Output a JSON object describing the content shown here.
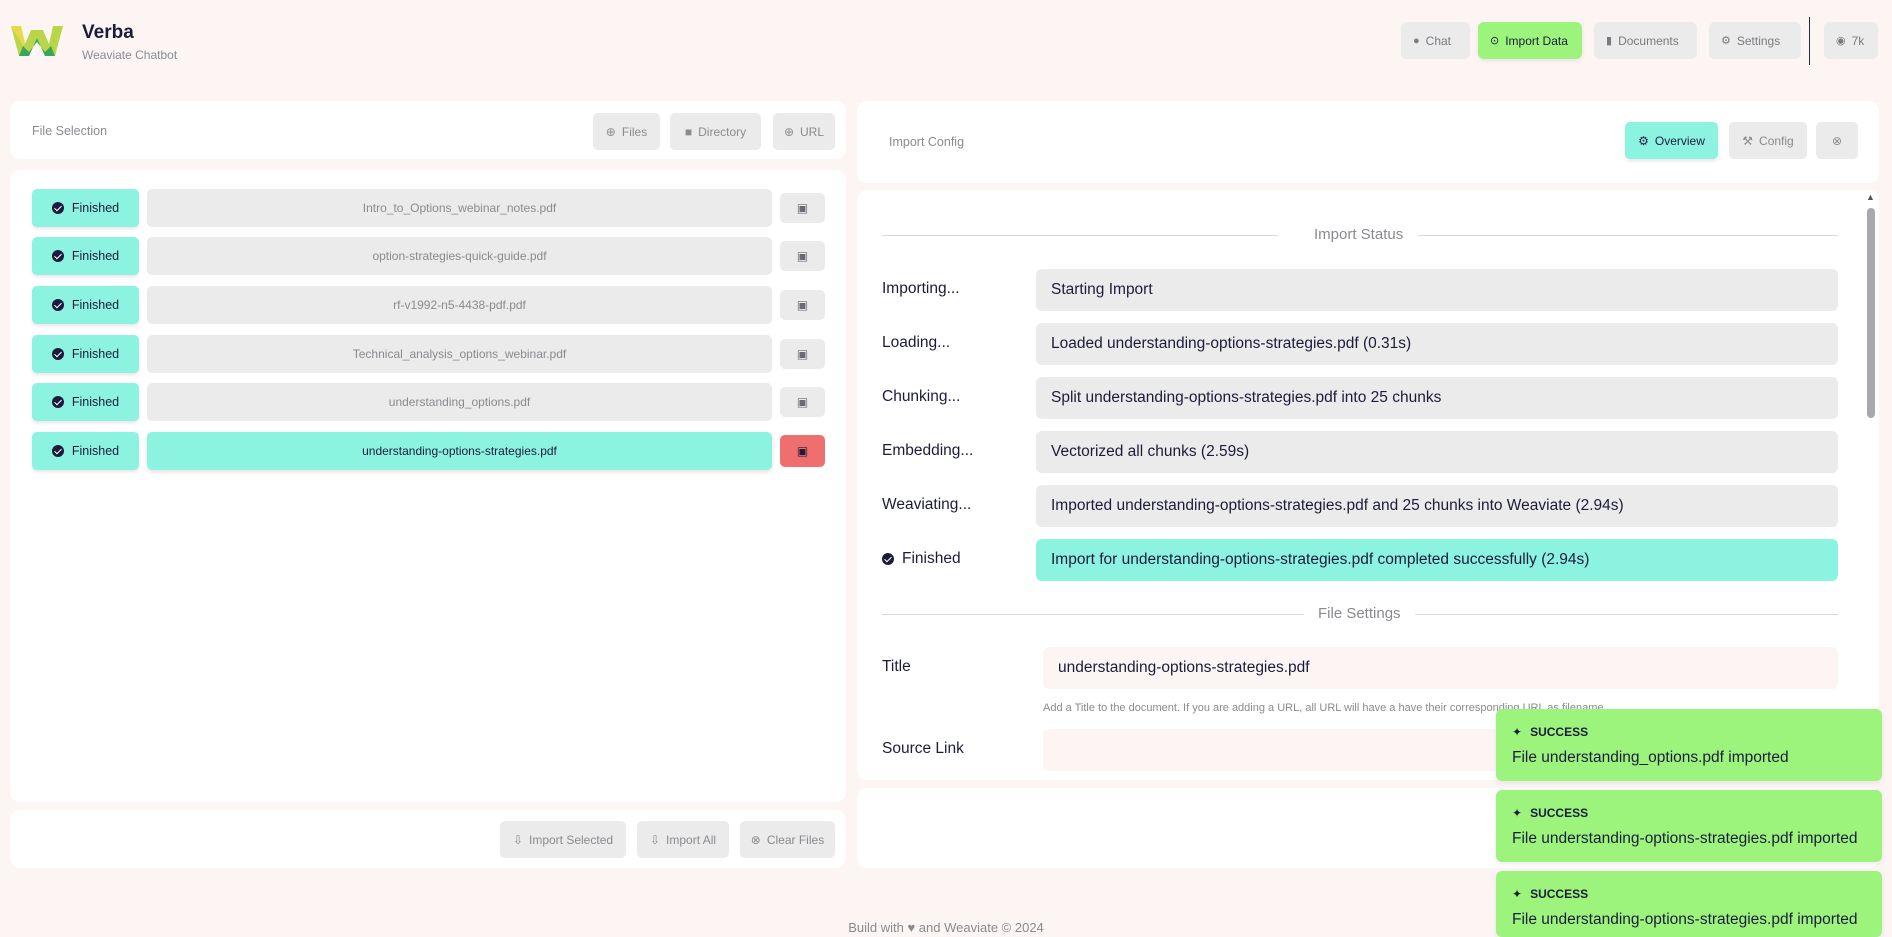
{
  "brand": {
    "title": "Verba",
    "subtitle": "Weaviate Chatbot"
  },
  "nav": {
    "chat": "Chat",
    "import": "Import Data",
    "documents": "Documents",
    "settings": "Settings",
    "github": "7k"
  },
  "file_selection": {
    "label": "File Selection",
    "files_btn": "Files",
    "directory_btn": "Directory",
    "url_btn": "URL",
    "rows": [
      {
        "status": "Finished",
        "name": "Intro_to_Options_webinar_notes.pdf"
      },
      {
        "status": "Finished",
        "name": "option-strategies-quick-guide.pdf"
      },
      {
        "status": "Finished",
        "name": "rf-v1992-n5-4438-pdf.pdf"
      },
      {
        "status": "Finished",
        "name": "Technical_analysis_options_webinar.pdf"
      },
      {
        "status": "Finished",
        "name": "understanding_options.pdf"
      },
      {
        "status": "Finished",
        "name": "understanding-options-strategies.pdf"
      }
    ],
    "import_selected": "Import Selected",
    "import_all": "Import All",
    "clear_files": "Clear Files"
  },
  "import_config": {
    "label": "Import Config",
    "overview_btn": "Overview",
    "config_btn": "Config",
    "status_title": "Import Status",
    "statuses": [
      {
        "label": "Importing...",
        "value": "Starting Import"
      },
      {
        "label": "Loading...",
        "value": "Loaded understanding-options-strategies.pdf (0.31s)"
      },
      {
        "label": "Chunking...",
        "value": "Split understanding-options-strategies.pdf into 25 chunks"
      },
      {
        "label": "Embedding...",
        "value": "Vectorized all chunks (2.59s)"
      },
      {
        "label": "Weaviating...",
        "value": "Imported understanding-options-strategies.pdf and 25 chunks into Weaviate (2.94s)"
      },
      {
        "label": "Finished",
        "value": "Import for understanding-options-strategies.pdf completed successfully (2.94s)"
      }
    ],
    "file_settings_title": "File Settings",
    "title_label": "Title",
    "title_value": "understanding-options-strategies.pdf",
    "title_hint": "Add a Title to the document. If you are adding a URL, all URL will have a have their corresponding URL as filename.",
    "source_label": "Source Link"
  },
  "toasts": [
    {
      "head": "SUCCESS",
      "msg": "File understanding_options.pdf imported"
    },
    {
      "head": "SUCCESS",
      "msg": "File understanding-options-strategies.pdf imported"
    },
    {
      "head": "SUCCESS",
      "msg": "File understanding-options-strategies.pdf imported"
    }
  ],
  "footer": "Build with ♥ and Weaviate © 2024",
  "colors": {
    "accent_green": "#9df47d",
    "accent_teal": "#8bf3e0",
    "danger": "#ef6f6f",
    "background": "#fcf5f4"
  },
  "icons": [
    "weaviate-logo",
    "chat-icon",
    "import-icon",
    "document-icon",
    "gear-icon",
    "github-icon",
    "plus-icon",
    "folder-icon",
    "check-icon",
    "trash-icon",
    "magic-wand-icon",
    "hammer-icon"
  ]
}
